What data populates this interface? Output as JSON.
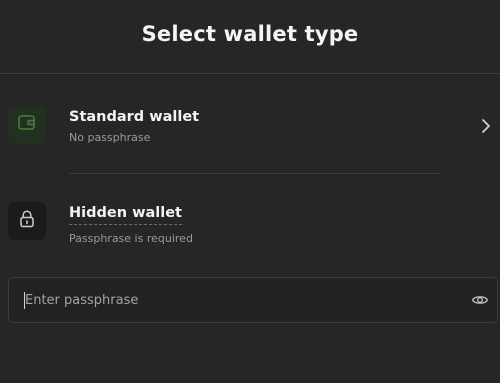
{
  "header": {
    "title": "Select wallet type"
  },
  "options": [
    {
      "title": "Standard wallet",
      "subtitle": "No passphrase",
      "icon": "wallet-icon",
      "accent": "#22301f"
    },
    {
      "title": "Hidden wallet",
      "subtitle": "Passphrase is required",
      "icon": "lock-icon"
    }
  ],
  "passphrase": {
    "value": "",
    "placeholder": "Enter passphrase",
    "toggle_icon": "eye-icon"
  },
  "colors": {
    "background": "#262626",
    "divider": "#3b3b3b",
    "text_primary": "#f3f3f3",
    "text_secondary": "#9a9a9a",
    "wallet_accent": "#4a7a3a"
  }
}
